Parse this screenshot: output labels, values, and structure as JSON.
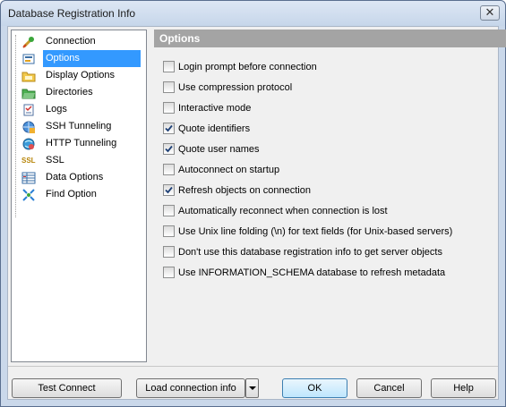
{
  "window": {
    "title": "Database Registration Info",
    "close_glyph": "✕"
  },
  "tree": {
    "items": [
      {
        "label": "Connection",
        "icon": "connection-icon",
        "selected": false
      },
      {
        "label": "Options",
        "icon": "options-icon",
        "selected": true
      },
      {
        "label": "Display Options",
        "icon": "display-options-icon",
        "selected": false
      },
      {
        "label": "Directories",
        "icon": "directories-icon",
        "selected": false
      },
      {
        "label": "Logs",
        "icon": "logs-icon",
        "selected": false
      },
      {
        "label": "SSH Tunneling",
        "icon": "ssh-tunneling-icon",
        "selected": false
      },
      {
        "label": "HTTP Tunneling",
        "icon": "http-tunneling-icon",
        "selected": false
      },
      {
        "label": "SSL",
        "icon": "ssl-icon",
        "selected": false
      },
      {
        "label": "Data Options",
        "icon": "data-options-icon",
        "selected": false
      },
      {
        "label": "Find Option",
        "icon": "find-option-icon",
        "selected": false
      }
    ],
    "ssl_icon_text": "SSL"
  },
  "panel": {
    "title": "Options"
  },
  "options": [
    {
      "label": "Login prompt before connection",
      "checked": false
    },
    {
      "label": "Use compression protocol",
      "checked": false
    },
    {
      "label": "Interactive mode",
      "checked": false
    },
    {
      "label": "Quote identifiers",
      "checked": true
    },
    {
      "label": "Quote user names",
      "checked": true
    },
    {
      "label": "Autoconnect on startup",
      "checked": false
    },
    {
      "label": "Refresh objects on connection",
      "checked": true
    },
    {
      "label": "Automatically reconnect when connection is lost",
      "checked": false
    },
    {
      "label": "Use Unix line folding (\\n) for text fields (for Unix-based servers)",
      "checked": false
    },
    {
      "label": "Don't use this database registration info to get server objects",
      "checked": false
    },
    {
      "label": "Use INFORMATION_SCHEMA database to refresh metadata",
      "checked": false
    }
  ],
  "buttons": {
    "test_connect": "Test Connect",
    "load_connection_info": "Load connection info",
    "ok": "OK",
    "cancel": "Cancel",
    "help": "Help"
  },
  "colors": {
    "selection": "#3399ff",
    "header_bg": "#a4a4a4"
  }
}
